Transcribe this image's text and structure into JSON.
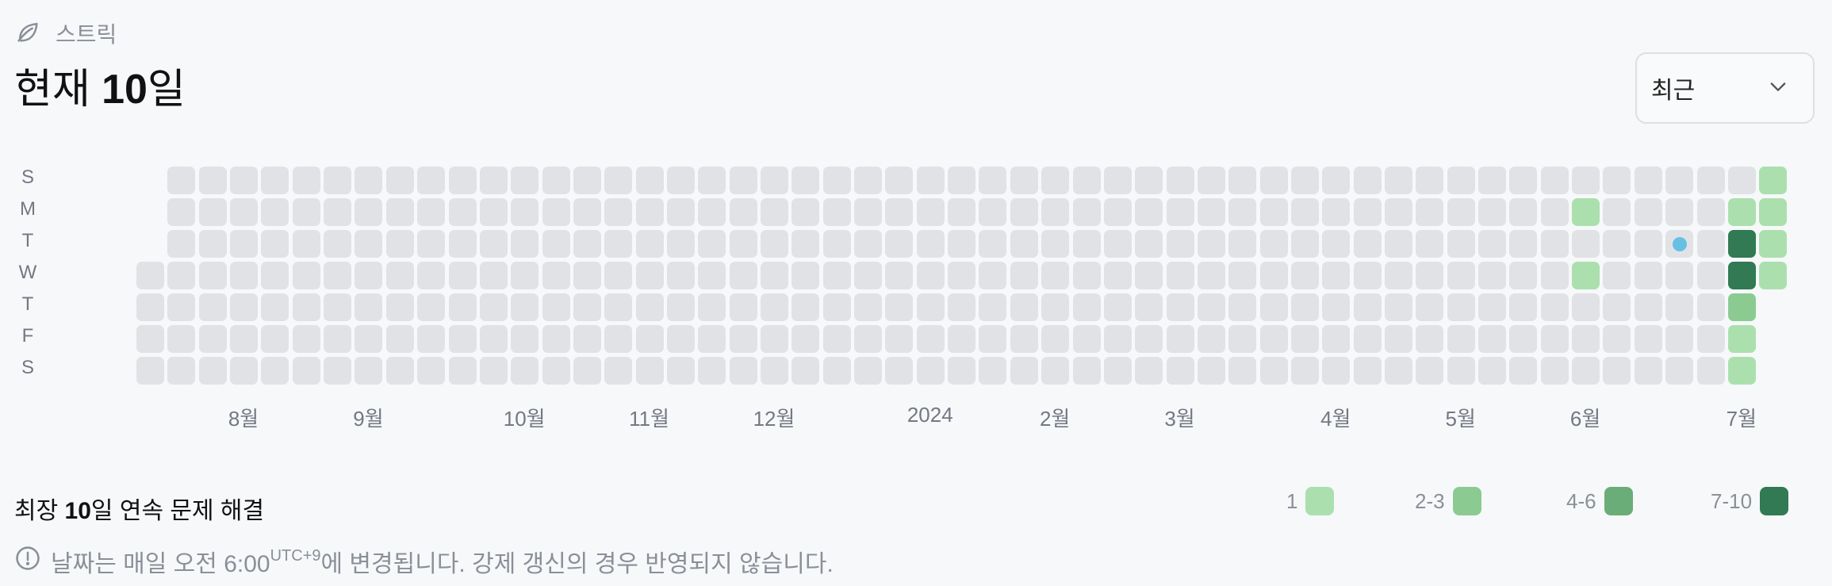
{
  "section": {
    "icon": "leaf-icon",
    "label": "스트릭"
  },
  "streak": {
    "prefix": "현재 ",
    "value": "10",
    "suffix": "일"
  },
  "period_select": {
    "selected": "최근",
    "icon": "chevron-down-icon"
  },
  "day_labels": [
    "S",
    "M",
    "T",
    "W",
    "T",
    "F",
    "S"
  ],
  "months": [
    {
      "label": "8월",
      "week": 3
    },
    {
      "label": "9월",
      "week": 7
    },
    {
      "label": "10월",
      "week": 12
    },
    {
      "label": "11월",
      "week": 16
    },
    {
      "label": "12월",
      "week": 20
    },
    {
      "label": "2024",
      "week": 25
    },
    {
      "label": "2월",
      "week": 29
    },
    {
      "label": "3월",
      "week": 33
    },
    {
      "label": "4월",
      "week": 38
    },
    {
      "label": "5월",
      "week": 42
    },
    {
      "label": "6월",
      "week": 46
    },
    {
      "label": "7월",
      "week": 51
    }
  ],
  "grid": {
    "weeks": 53,
    "first_week_start_day": 3,
    "last_week_end_day": 3,
    "active": [
      {
        "week": 46,
        "day": 1,
        "level": 1
      },
      {
        "week": 46,
        "day": 3,
        "level": 1
      },
      {
        "week": 51,
        "day": 1,
        "level": 1
      },
      {
        "week": 51,
        "day": 2,
        "level": 4
      },
      {
        "week": 51,
        "day": 3,
        "level": 4
      },
      {
        "week": 51,
        "day": 4,
        "level": 2
      },
      {
        "week": 51,
        "day": 5,
        "level": 1
      },
      {
        "week": 51,
        "day": 6,
        "level": 1
      },
      {
        "week": 52,
        "day": 0,
        "level": 1
      },
      {
        "week": 52,
        "day": 1,
        "level": 1
      },
      {
        "week": 52,
        "day": 2,
        "level": 1
      },
      {
        "week": 52,
        "day": 3,
        "level": 1
      }
    ],
    "marker": {
      "week": 49,
      "day": 2
    }
  },
  "colors": {
    "empty": "#e1e2e5",
    "level1": "#abe0ae",
    "level2": "#8bcb92",
    "level3": "#6aad78",
    "level4": "#327a53",
    "marker": "#67bfe6"
  },
  "longest": {
    "prefix": "최장 ",
    "value": "10",
    "suffix": "일 연속 문제 해결"
  },
  "legend": [
    {
      "label": "1",
      "level": 1
    },
    {
      "label": "2-3",
      "level": 2
    },
    {
      "label": "4-6",
      "level": 3
    },
    {
      "label": "7-10",
      "level": 4
    }
  ],
  "notice": {
    "icon": "info-icon",
    "before": "날짜는 매일 오전 6:00",
    "sup": "UTC+9",
    "after": "에 변경됩니다. 강제 갱신의 경우 반영되지 않습니다."
  }
}
